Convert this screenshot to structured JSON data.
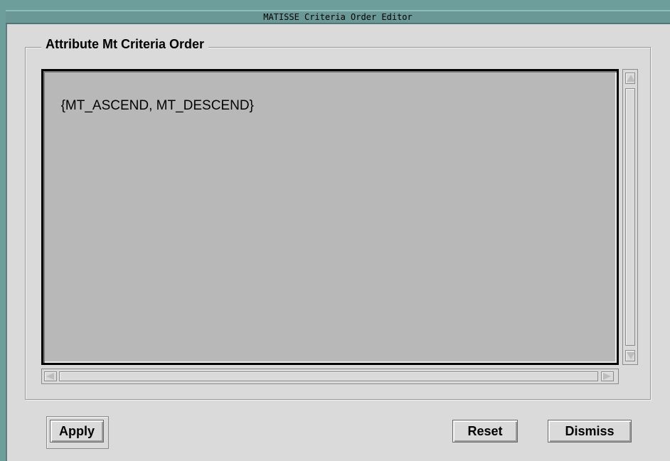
{
  "window": {
    "title": "MATISSE Criteria Order Editor"
  },
  "frame": {
    "title": "Attribute Mt Criteria Order"
  },
  "editor": {
    "value": "{MT_ASCEND, MT_DESCEND}"
  },
  "buttons": {
    "apply": "Apply",
    "reset": "Reset",
    "dismiss": "Dismiss"
  },
  "icons": {
    "scroll_up": "arrow-up-icon",
    "scroll_down": "arrow-down-icon",
    "scroll_left": "arrow-left-icon",
    "scroll_right": "arrow-right-icon"
  },
  "colors": {
    "titlebar": "#6a9896",
    "window_bg": "#dadada",
    "text_area_bg": "#b8b8b8"
  }
}
